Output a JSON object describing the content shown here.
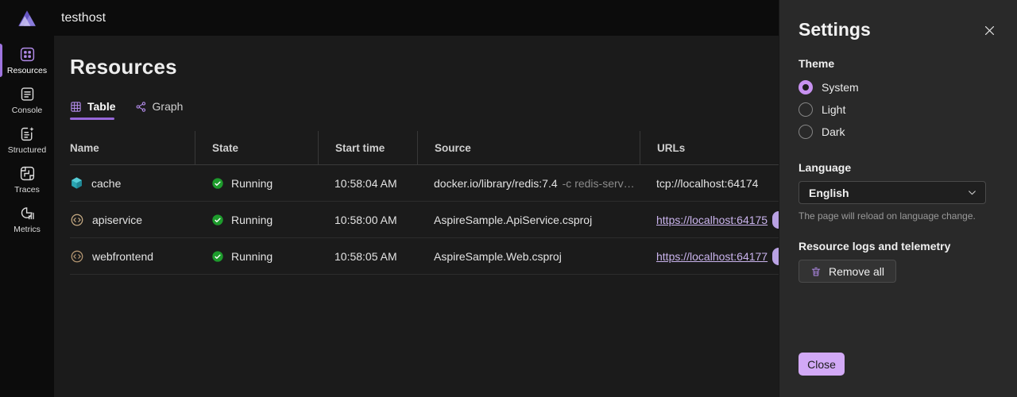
{
  "app": {
    "title": "testhost"
  },
  "sidebar": {
    "items": [
      {
        "label": "Resources",
        "active": true
      },
      {
        "label": "Console",
        "active": false
      },
      {
        "label": "Structured",
        "active": false
      },
      {
        "label": "Traces",
        "active": false
      },
      {
        "label": "Metrics",
        "active": false
      }
    ]
  },
  "main": {
    "title": "Resources",
    "tabs": [
      {
        "label": "Table",
        "active": true
      },
      {
        "label": "Graph",
        "active": false
      }
    ],
    "table": {
      "columns": [
        "Name",
        "State",
        "Start time",
        "Source",
        "URLs"
      ],
      "rows": [
        {
          "name": "cache",
          "state": "Running",
          "start_time": "10:58:04 AM",
          "source": "docker.io/library/redis:7.4",
          "source_args": "-c redis-serv…",
          "url": "tcp://localhost:64174"
        },
        {
          "name": "apiservice",
          "state": "Running",
          "start_time": "10:58:00 AM",
          "source": "AspireSample.ApiService.csproj",
          "source_args": "",
          "url": "https://localhost:64175"
        },
        {
          "name": "webfrontend",
          "state": "Running",
          "start_time": "10:58:05 AM",
          "source": "AspireSample.Web.csproj",
          "source_args": "",
          "url": "https://localhost:64177"
        }
      ]
    }
  },
  "settings": {
    "title": "Settings",
    "theme_label": "Theme",
    "theme_options": [
      {
        "label": "System",
        "selected": true
      },
      {
        "label": "Light",
        "selected": false
      },
      {
        "label": "Dark",
        "selected": false
      }
    ],
    "language_label": "Language",
    "language_value": "English",
    "language_hint": "The page will reload on language change.",
    "telemetry_label": "Resource logs and telemetry",
    "remove_all_label": "Remove all",
    "close_label": "Close"
  },
  "colors": {
    "accent_purple": "#9f75e0",
    "link_purple": "#c9b3ec",
    "primary_button": "#d2a9f6",
    "running_green": "#1d9b2c",
    "container_teal": "#2aa5b2"
  }
}
